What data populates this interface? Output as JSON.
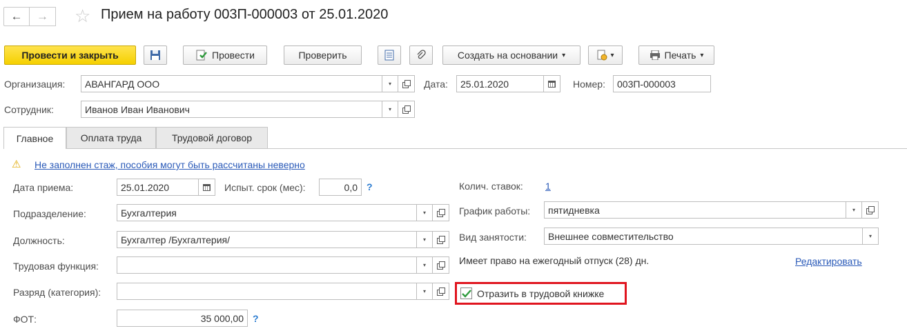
{
  "header": {
    "title": "Прием на работу 003П-000003 от 25.01.2020",
    "back_icon": "←",
    "forward_icon": "→",
    "star_icon": "☆"
  },
  "toolbar": {
    "post_close": "Провести и закрыть",
    "post": "Провести",
    "check": "Проверить",
    "create_based": "Создать на основании",
    "print": "Печать",
    "dropdown_arrow": "▾"
  },
  "org": {
    "label": "Организация:",
    "value": "АВАНГАРД ООО"
  },
  "date": {
    "label": "Дата:",
    "value": "25.01.2020"
  },
  "number": {
    "label": "Номер:",
    "value": "003П-000003"
  },
  "employee": {
    "label": "Сотрудник:",
    "value": "Иванов Иван Иванович"
  },
  "tabs": [
    {
      "label": "Главное"
    },
    {
      "label": "Оплата труда"
    },
    {
      "label": "Трудовой договор"
    }
  ],
  "warning": {
    "icon": "⚠",
    "text": "Не заполнен стаж, пособия могут быть рассчитаны неверно"
  },
  "main": {
    "hire_date_label": "Дата приема:",
    "hire_date": "25.01.2020",
    "probation_label": "Испыт. срок (мес):",
    "probation": "0,0",
    "help": "?",
    "department_label": "Подразделение:",
    "department": "Бухгалтерия",
    "position_label": "Должность:",
    "position": "Бухгалтер /Бухгалтерия/",
    "labor_function_label": "Трудовая функция:",
    "labor_function": "",
    "grade_label": "Разряд (категория):",
    "grade": "",
    "fot_label": "ФОТ:",
    "fot": "35 000,00",
    "rates_label": "Колич. ставок:",
    "rates": "1",
    "schedule_label": "График работы:",
    "schedule": "пятидневка",
    "employment_label": "Вид занятости:",
    "employment": "Внешнее совместительство",
    "vacation_text": "Имеет право на ежегодный отпуск (28) дн.",
    "edit_link": "Редактировать",
    "workbook_checkbox": "Отразить в трудовой книжке",
    "workbook_checked": true,
    "highlight_color": "#e0141e"
  }
}
